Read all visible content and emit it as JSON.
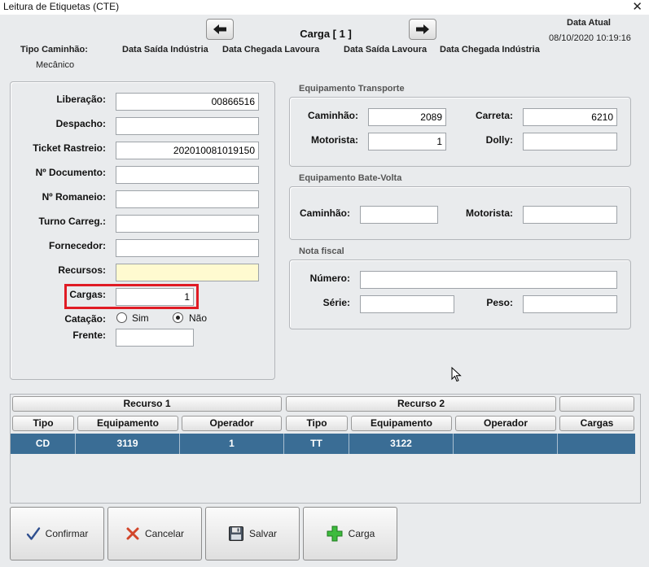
{
  "window": {
    "title": "Leitura de Etiquetas (CTE)",
    "close_glyph": "✕"
  },
  "header": {
    "carga_title": "Carga [ 1 ]",
    "data_atual_label": "Data Atual",
    "data_atual_value": "08/10/2020 10:19:16",
    "tipo_caminhao_label": "Tipo Caminhão:",
    "tipo_caminhao_value": "Mecânico",
    "data_saida_industria_1": "Data Saída Indústria",
    "data_chegada_lavoura": "Data Chegada Lavoura",
    "data_saida_lavoura": "Data Saída Lavoura",
    "data_chegada_industria": "Data Chegada Indústria"
  },
  "left_form": {
    "liberacao_label": "Liberação:",
    "liberacao_value": "00866516",
    "despacho_label": "Despacho:",
    "despacho_value": "",
    "ticket_label": "Ticket Rastreio:",
    "ticket_value": "202010081019150",
    "documento_label": "Nº Documento:",
    "documento_value": "",
    "romaneio_label": "Nº Romaneio:",
    "romaneio_value": "",
    "turno_label": "Turno Carreg.:",
    "turno_value": "",
    "fornecedor_label": "Fornecedor:",
    "fornecedor_value": "",
    "recursos_label": "Recursos:",
    "recursos_value": "",
    "cargas_label": "Cargas:",
    "cargas_value": "1",
    "catacao_label": "Catação:",
    "catacao_sim": "Sim",
    "catacao_nao": "Não",
    "frente_label": "Frente:",
    "frente_value": ""
  },
  "transporte": {
    "title": "Equipamento Transporte",
    "caminhao_label": "Caminhão:",
    "caminhao_value": "2089",
    "carreta_label": "Carreta:",
    "carreta_value": "6210",
    "motorista_label": "Motorista:",
    "motorista_value": "1",
    "dolly_label": "Dolly:",
    "dolly_value": ""
  },
  "bate_volta": {
    "title": "Equipamento Bate-Volta",
    "caminhao_label": "Caminhão:",
    "caminhao_value": "",
    "motorista_label": "Motorista:",
    "motorista_value": ""
  },
  "nota_fiscal": {
    "title": "Nota fiscal",
    "numero_label": "Número:",
    "numero_value": "",
    "serie_label": "Série:",
    "serie_value": "",
    "peso_label": "Peso:",
    "peso_value": ""
  },
  "grid": {
    "group1": "Recurso 1",
    "group2": "Recurso 2",
    "group3": "",
    "columns": [
      "Tipo",
      "Equipamento",
      "Operador",
      "Tipo",
      "Equipamento",
      "Operador",
      "Cargas"
    ],
    "row": [
      "CD",
      "3119",
      "1",
      "TT",
      "3122",
      "",
      ""
    ],
    "row_color": "#3a6d95"
  },
  "buttons": {
    "confirmar": "Confirmar",
    "cancelar": "Cancelar",
    "salvar": "Salvar",
    "carga": "Carga"
  },
  "icons": {
    "prev": "arrow-left-icon",
    "next": "arrow-right-icon",
    "confirm": "checkmark-icon",
    "cancel": "x-icon",
    "save": "floppy-disk-icon",
    "add": "plus-icon"
  }
}
